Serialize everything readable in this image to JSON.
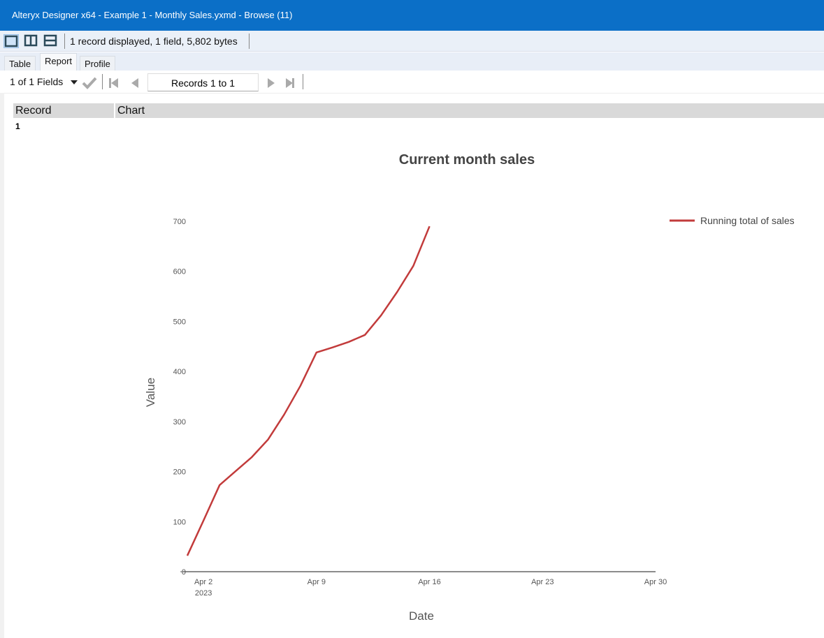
{
  "window": {
    "title": "Alteryx Designer x64 - Example 1 - Monthly Sales.yxmd - Browse (11)"
  },
  "toolbar": {
    "status": "1 record displayed, 1 field, 5,802 bytes"
  },
  "tabs": [
    {
      "label": "Table"
    },
    {
      "label": "Report"
    },
    {
      "label": "Profile"
    }
  ],
  "nav": {
    "fields": "1 of 1 Fields",
    "records": "Records 1 to 1"
  },
  "grid": {
    "headers": [
      "Record",
      "Chart"
    ],
    "rows": [
      {
        "record": "1"
      }
    ]
  },
  "colors": {
    "titlebar": "#0b6fc7",
    "line": "#c23b3b"
  },
  "chart_data": {
    "type": "line",
    "title": "Current month sales",
    "xlabel": "Date",
    "ylabel": "Value",
    "xlim_days": [
      1,
      30
    ],
    "ylim": [
      0,
      700
    ],
    "x_ticks": [
      {
        "day": 2,
        "label": "Apr 2",
        "sub": "2023"
      },
      {
        "day": 9,
        "label": "Apr 9"
      },
      {
        "day": 16,
        "label": "Apr 16"
      },
      {
        "day": 23,
        "label": "Apr 23"
      },
      {
        "day": 30,
        "label": "Apr 30"
      }
    ],
    "y_ticks": [
      0,
      100,
      200,
      300,
      400,
      500,
      600,
      700
    ],
    "legend": {
      "position": "top-right"
    },
    "series": [
      {
        "name": "Running total of sales",
        "x": [
          1,
          2,
          3,
          4,
          5,
          6,
          7,
          8,
          9,
          10,
          11,
          12,
          13,
          14,
          15,
          16
        ],
        "values": [
          32,
          102,
          173,
          201,
          229,
          264,
          314,
          371,
          438,
          448,
          459,
          473,
          512,
          559,
          611,
          690
        ]
      }
    ]
  }
}
